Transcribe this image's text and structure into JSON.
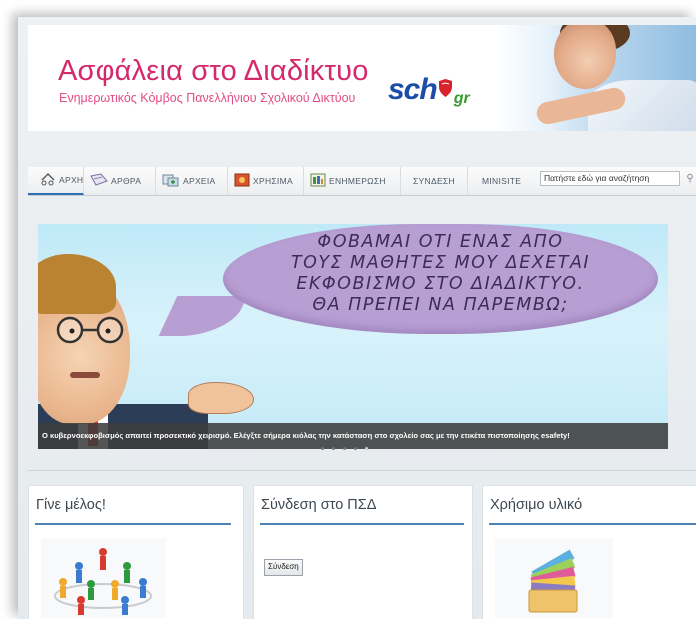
{
  "header": {
    "title": "Ασφάλεια στο Διαδίκτυο",
    "subtitle": "Ενημερωτικός Κόμβος Πανελλήνιου Σχολικού Δικτύου",
    "logo": {
      "sch": "sch",
      "gr": "gr"
    }
  },
  "nav": {
    "items": [
      {
        "label": "ΑΡΧΗ",
        "icon": "home-icon"
      },
      {
        "label": "ΑΡΘΡΑ",
        "icon": "articles-icon"
      },
      {
        "label": "ΑΡΧΕΙΑ",
        "icon": "files-icon"
      },
      {
        "label": "ΧΡΗΣΙΜΑ",
        "icon": "tools-icon"
      },
      {
        "label": "ΕΝΗΜΕΡΩΣΗ",
        "icon": "news-icon"
      },
      {
        "label": "ΣΥΝΔΕΣΗ",
        "icon": ""
      },
      {
        "label": "MINISITE",
        "icon": ""
      }
    ],
    "search_placeholder": "Πατήστε εδώ για αναζήτηση",
    "search_icon": "search-icon"
  },
  "slider": {
    "bubble_lines": [
      "ΦΟΒΑΜΑΙ ΟΤΙ ΕΝΑΣ ΑΠΟ",
      "ΤΟΥΣ ΜΑΘΗΤΕΣ ΜΟΥ ΔΕΧΕΤΑΙ",
      "ΕΚΦΟΒΙΣΜΟ ΣΤΟ ΔΙΑΔΙΚΤΥΟ.",
      "ΘΑ ΠΡΕΠΕΙ ΝΑ ΠΑΡΕΜΒΩ;"
    ],
    "caption": "Ο κυβερνοεκφοβισμός απαιτεί προσεκτικό χειρισμό. Ελέγξτε σήμερα κιόλας την κατάσταση στο σχολείο σας με την ετικέτα πιστοποίησης esafety!",
    "dot_count": 5,
    "active_dot": 4
  },
  "panels": [
    {
      "title": "Γίνε μέλος!"
    },
    {
      "title": "Σύνδεση στο ΠΣΔ",
      "button": "Σύνδεση"
    },
    {
      "title": "Χρήσιμο υλικό"
    }
  ],
  "colors": {
    "title_pink": "#d42a6a",
    "logo_blue": "#1a4ca8",
    "bubble_purple": "#b89fd3",
    "accent_blue": "#4d82b7"
  }
}
